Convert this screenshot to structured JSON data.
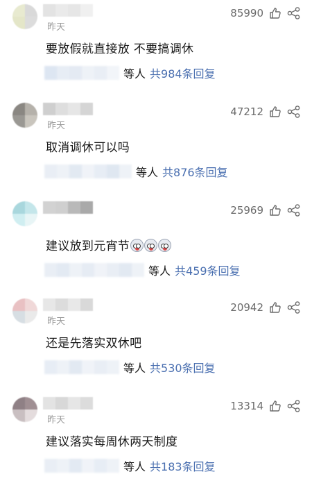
{
  "comments": [
    {
      "time": "昨天",
      "likes": "85990",
      "text": "要放假就直接放 不要搞调休",
      "reply_suffix": "等人",
      "reply_link": "共984条回复",
      "colors": {
        "avatar": [
          "#e8ead0",
          "#d9d9d9",
          "#e4e6c8",
          "#dcdcdc"
        ],
        "name": [
          "#e3e3e3",
          "#eaeaea",
          "#e6e6e6",
          "#f0f0f0"
        ],
        "blur": [
          "#dde6f2",
          "#e7edf5",
          "#e4eaf3",
          "#eef2f7",
          "#e9eef5",
          "#f2f5f9"
        ]
      },
      "emoji_count": 0
    },
    {
      "time": "昨天",
      "likes": "47212",
      "text": "取消调休可以吗",
      "reply_suffix": "等人",
      "reply_link": "共876条回复",
      "colors": {
        "avatar": [
          "#8a8782",
          "#b5b1aa",
          "#9a9893",
          "#c9c5bd"
        ],
        "name": [
          "#cfcfcf",
          "#dedede",
          "#e6e6e6",
          "#d5d5d5"
        ],
        "blur": [
          "#e9eef5",
          "#eef2f7",
          "#e2e9f2",
          "#f0f3f8",
          "#e7edf5",
          "#dfe7f1",
          "#eef2f7"
        ]
      },
      "emoji_count": 0
    },
    {
      "time": "",
      "likes": "25969",
      "text": "建议放到元宵节",
      "reply_suffix": "等人",
      "reply_link": "共459条回复",
      "colors": {
        "avatar": [
          "#a9d7dd",
          "#c4e6ea",
          "#d0eef1",
          "#e8f5f6"
        ],
        "name": [
          "#d2d2d2",
          "#cfcfcf",
          "#b9b9b9",
          "#a9a9a9"
        ],
        "blur": [
          "#e9eef5",
          "#e3eaf3",
          "#eef2f7",
          "#e6ecf4",
          "#f0f3f8",
          "#e9eef5",
          "#e2e9f2",
          "#eef2f7"
        ]
      },
      "emoji_count": 3
    },
    {
      "time": "昨天",
      "likes": "20942",
      "text": "还是先落实双休吧",
      "reply_suffix": "等人",
      "reply_link": "共530条回复",
      "colors": {
        "avatar": [
          "#e9c1c3",
          "#f0d8d8",
          "#d7dee3",
          "#eaeaea"
        ],
        "name": [
          "#e7e7e7",
          "#dcdcdc",
          "#e8e8e8",
          "#d9d9d9"
        ],
        "blur": [
          "#e7edf5",
          "#eef2f7",
          "#e2e9f2",
          "#f0f3f8",
          "#e9eef5",
          "#eef2f7"
        ]
      },
      "emoji_count": 0
    },
    {
      "time": "昨天",
      "likes": "13314",
      "text": "建议落实每周休两天制度",
      "reply_suffix": "等人",
      "reply_link": "共183条回复",
      "colors": {
        "avatar": [
          "#8f8085",
          "#a08f93",
          "#c9bfc1",
          "#e4dcdd"
        ],
        "name": [
          "#e3e3e3",
          "#d8d8d8",
          "#e6e6e6",
          "#dcdcdc"
        ],
        "blur": [
          "#e9eef5",
          "#eef2f7",
          "#e3eaf3",
          "#f0f3f8",
          "#e7edf5",
          "#eef2f7"
        ]
      },
      "emoji_count": 0
    }
  ]
}
